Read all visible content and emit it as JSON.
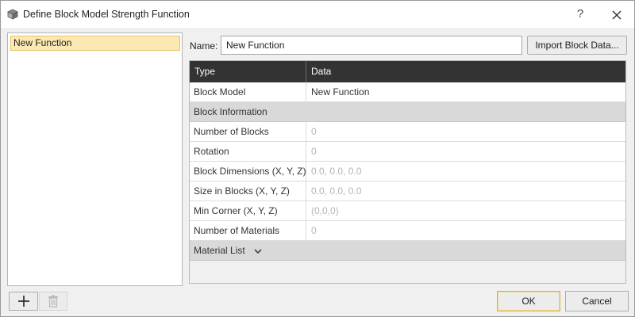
{
  "window": {
    "title": "Define Block Model Strength Function",
    "help_label": "?",
    "app_icon": "block-model-icon",
    "close_icon": "close-icon"
  },
  "function_list": {
    "items": [
      {
        "label": "New Function",
        "selected": true
      }
    ]
  },
  "name_field": {
    "label": "Name:",
    "value": "New Function"
  },
  "import_button": {
    "label": "Import Block Data..."
  },
  "grid": {
    "headers": {
      "type": "Type",
      "data": "Data"
    },
    "block_model": {
      "label": "Block Model",
      "value": "New Function"
    },
    "block_info_section": "Block Information",
    "rows": [
      {
        "label": "Number of Blocks",
        "value": "0"
      },
      {
        "label": "Rotation",
        "value": "0"
      },
      {
        "label": "Block Dimensions (X, Y, Z)",
        "value": "0.0, 0.0, 0.0"
      },
      {
        "label": "Size in Blocks (X, Y, Z)",
        "value": "0.0, 0.0, 0.0"
      },
      {
        "label": "Min Corner (X, Y, Z)",
        "value": "(0,0,0)"
      },
      {
        "label": "Number of Materials",
        "value": "0"
      }
    ],
    "material_section": {
      "label": "Material List",
      "icon": "chevron-down-icon"
    }
  },
  "bottom_left": {
    "add_icon": "plus-icon",
    "delete_icon": "trash-icon"
  },
  "buttons": {
    "ok": "OK",
    "cancel": "Cancel"
  },
  "colors": {
    "header_bg": "#333333",
    "section_bg": "#d9d9d9",
    "selected_bg": "#fce8b2",
    "ok_border": "#d9b04a"
  }
}
